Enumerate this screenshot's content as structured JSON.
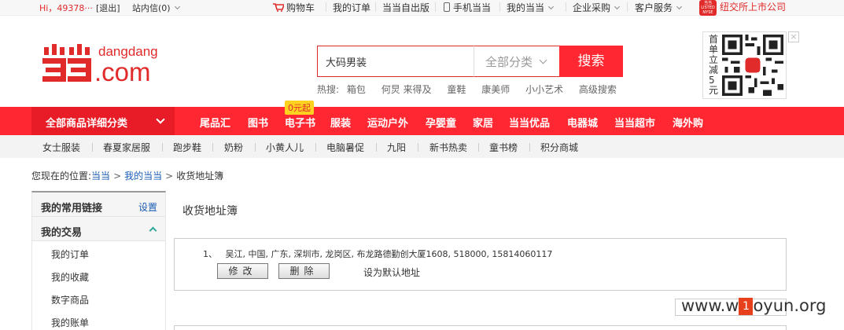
{
  "topbar": {
    "user": "Hi，49378···",
    "logout": "[退出]",
    "inbox": "站内信(0)",
    "links": [
      "购物车",
      "我的订单",
      "当当自出版",
      "手机当当",
      "我的当当",
      "企业采购",
      "客户服务"
    ],
    "nyse_badge": "当当 LISTED NYSE",
    "nyse_text": "纽交所上市公司"
  },
  "logo": {
    "brand": "dangdang",
    "domain": ".com"
  },
  "search": {
    "value": "大码男装",
    "category": "全部分类",
    "button": "搜索",
    "hot_label": "热搜:",
    "hot": [
      "箱包",
      "何炅 来得及",
      "童鞋",
      "康美师",
      "小小艺术"
    ],
    "advanced": "高级搜索"
  },
  "qr": {
    "text": "首单立减5元"
  },
  "nav": {
    "all_categories": "全部商品详细分类",
    "items": [
      "尾品汇",
      "图书",
      "电子书",
      "服装",
      "运动户外",
      "孕婴童",
      "家居",
      "当当优品",
      "电器城",
      "当当超市",
      "海外购"
    ],
    "ebook_badge": "0元起"
  },
  "subnav": [
    "女士服装",
    "春夏家居服",
    "跑步鞋",
    "奶粉",
    "小黄人儿",
    "电脑暑促",
    "九阳",
    "新书热卖",
    "童书榜",
    "积分商城"
  ],
  "breadcrumb": {
    "prefix": "您现在的位置:",
    "home": "当当",
    "mine": "我的当当",
    "current": "收货地址簿"
  },
  "sidebar": {
    "common_links": "我的常用链接",
    "settings": "设置",
    "trades": "我的交易",
    "links": [
      "我的订单",
      "我的收藏",
      "数字商品",
      "我的账单"
    ]
  },
  "main": {
    "title": "收货地址簿",
    "address_index": "1、",
    "address": "吴江, 中国, 广东, 深圳市, 龙岗区, 布龙路德勤创大厦1608, 518000, 15814060117",
    "edit": "修改",
    "delete": "删除",
    "set_default": "设为默认地址"
  },
  "watermark": {
    "pre": "www.w",
    "badge": "1",
    "post": "oyun.org"
  }
}
